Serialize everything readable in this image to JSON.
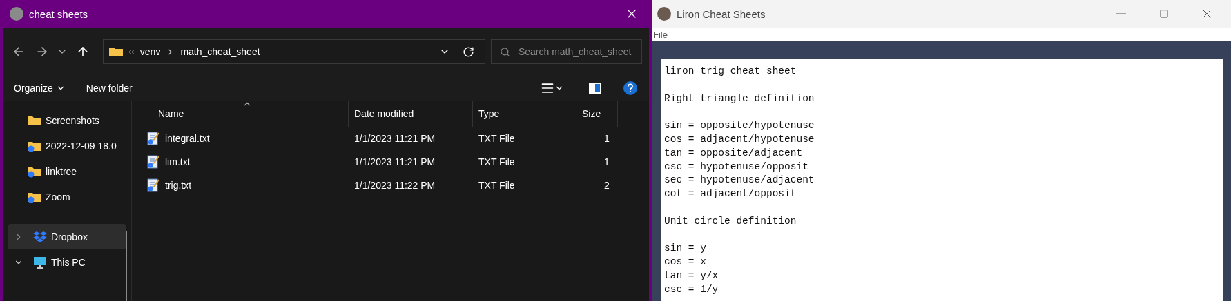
{
  "explorer": {
    "title": "cheat sheets",
    "breadcrumb": [
      "venv",
      "math_cheat_sheet"
    ],
    "search": {
      "placeholder": "Search math_cheat_sheet"
    },
    "commands": [
      "Organize",
      "New folder"
    ],
    "sidebar": {
      "items": [
        {
          "label": "Screenshots",
          "kind": "folder",
          "selected": false
        },
        {
          "label": "2022-12-09 18.0",
          "kind": "synced-folder",
          "selected": false
        },
        {
          "label": "linktree",
          "kind": "synced-folder",
          "selected": false
        },
        {
          "label": "Zoom",
          "kind": "synced-folder",
          "selected": false
        },
        {
          "label": "Dropbox",
          "kind": "dropbox",
          "selected": true,
          "expanded": false
        },
        {
          "label": "This PC",
          "kind": "pc",
          "selected": false,
          "expanded": true
        }
      ]
    },
    "table": {
      "columns": [
        "Name",
        "Date modified",
        "Type",
        "Size"
      ],
      "rows": [
        {
          "name": "integral.txt",
          "date": "1/1/2023 11:21 PM",
          "type": "TXT File",
          "size": "1"
        },
        {
          "name": "lim.txt",
          "date": "1/1/2023 11:21 PM",
          "type": "TXT File",
          "size": "1"
        },
        {
          "name": "trig.txt",
          "date": "1/1/2023 11:22 PM",
          "type": "TXT File",
          "size": "2"
        }
      ]
    }
  },
  "viewer": {
    "title": "Liron Cheat Sheets",
    "menu": [
      "File"
    ],
    "blocks": [
      [
        "liron trig cheat sheet"
      ],
      [
        "Right triangle definition"
      ],
      [
        "sin = opposite/hypotenuse",
        "cos = adjacent/hypotenuse",
        "tan = opposite/adjacent",
        "csc = hypotenuse/opposit",
        "sec = hypotenuse/adjacent",
        "cot = adjacent/opposit"
      ],
      [
        "Unit circle definition"
      ],
      [
        "sin = y",
        "cos = x",
        "tan = y/x",
        "csc = 1/y"
      ]
    ]
  }
}
